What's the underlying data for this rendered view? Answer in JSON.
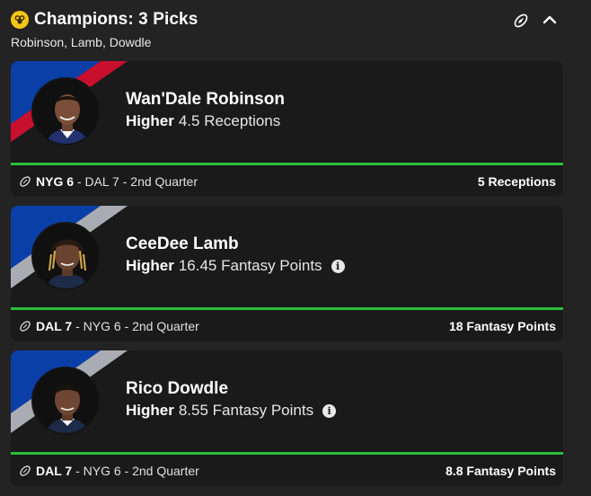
{
  "header": {
    "title": "Champions: 3 Picks",
    "subtitle": "Robinson, Lamb, Dowdle"
  },
  "colors": {
    "background": "#232323",
    "card": "#1a1a1a",
    "progress_green": "#2dbe3c",
    "trophy_gold": "#f5c518",
    "giants_blue": "#0b3fa8",
    "giants_red": "#c8102e",
    "cowboys_silver": "#a9adb3"
  },
  "picks": [
    {
      "name": "Wan'Dale Robinson",
      "direction": "Higher",
      "line": "4.5 Receptions",
      "has_info": false,
      "team": "NYG",
      "team_score": "NYG 6",
      "rest": " - DAL 7 - 2nd Quarter",
      "result": "5 Receptions",
      "progress": 1.0
    },
    {
      "name": "CeeDee Lamb",
      "direction": "Higher",
      "line": "16.45 Fantasy Points",
      "has_info": true,
      "team": "DAL",
      "team_score": "DAL 7",
      "rest": " - NYG 6 - 2nd Quarter",
      "result": "18 Fantasy Points",
      "progress": 1.0
    },
    {
      "name": "Rico Dowdle",
      "direction": "Higher",
      "line": "8.55 Fantasy Points",
      "has_info": true,
      "team": "DAL",
      "team_score": "DAL 7",
      "rest": " - NYG 6 - 2nd Quarter",
      "result": "8.8 Fantasy Points",
      "progress": 1.0
    }
  ],
  "icons": {
    "trophy": "trophy-icon",
    "football": "football-icon",
    "collapse": "chevron-up-icon",
    "info": "info-icon"
  }
}
